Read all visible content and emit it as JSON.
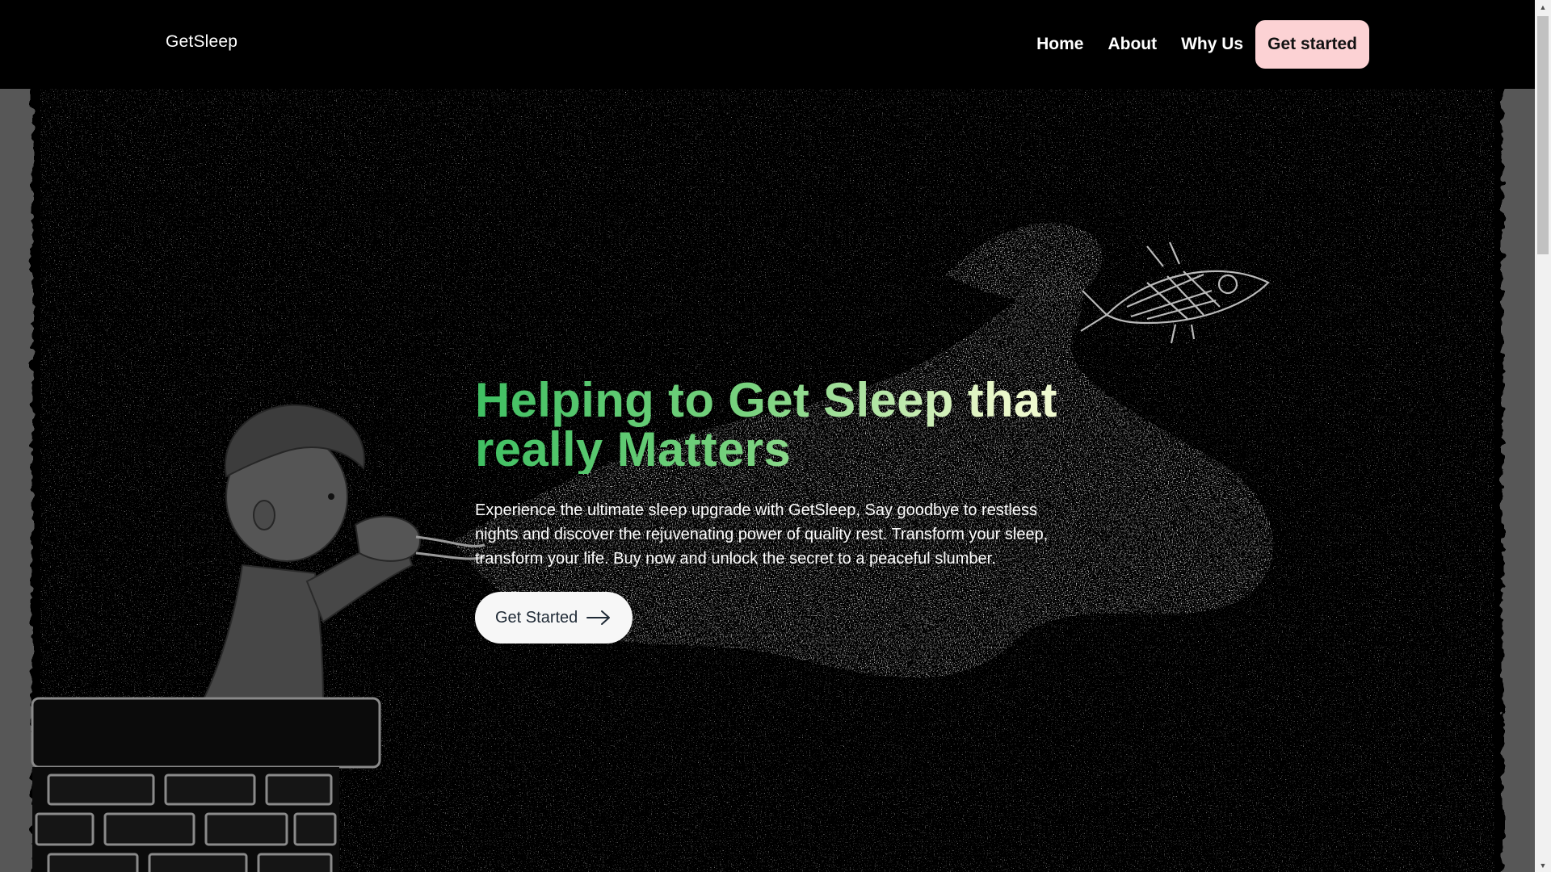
{
  "brand": {
    "name": "GetSleep"
  },
  "nav": {
    "items": [
      {
        "label": "Home"
      },
      {
        "label": "About"
      },
      {
        "label": "Why Us"
      }
    ],
    "cta_label": "Get started"
  },
  "hero": {
    "headline": "Helping to Get Sleep that really Matters",
    "description": "Experience the ultimate sleep upgrade with GetSleep, Say goodbye to restless nights and discover the rejuvenating power of quality rest. Transform your sleep, transform your life. Buy now and unlock the secret to a peaceful slumber.",
    "cta_label": "Get Started",
    "cta_icon": "arrow-right-icon"
  },
  "colors": {
    "background": "#000000",
    "frame": "#575757",
    "nav_cta": "#fcd2d4",
    "headline_start": "#3fbf62",
    "headline_end": "#f4fbd6",
    "button": "#f7f7f7"
  }
}
